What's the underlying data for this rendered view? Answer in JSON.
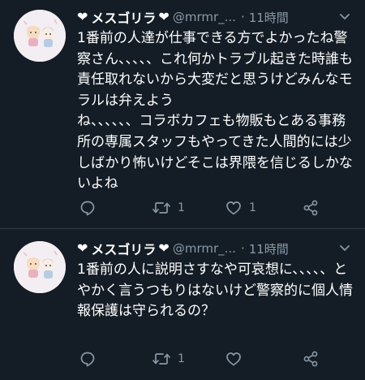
{
  "timeline": {
    "tweets": [
      {
        "heart_left": "❤",
        "display_name": "メスゴリラ",
        "heart_right": "❤",
        "handle": "@mrmr_...",
        "dot": "·",
        "time": "11時間",
        "text": "1番前の人達が仕事できる方でよかったね警察さん、、、、、これ何かトラブル起きた時誰も責任取れないから大変だと思うけどみんなモラルは弁えよう\nね、、、、、、コラボカフェも物販もとある事務所の専属スタッフもやってきた人間的には少しばかり怖いけどそこは界隈を信じるしかないよね",
        "reply_count": "",
        "retweet_count": "1",
        "like_count": "1",
        "icons": {
          "avatar": "avatar-image",
          "menu": "chevron-down-icon",
          "reply": "reply-icon",
          "retweet": "retweet-icon",
          "like": "heart-icon",
          "share": "share-icon"
        }
      },
      {
        "heart_left": "❤",
        "display_name": "メスゴリラ",
        "heart_right": "❤",
        "handle": "@mrmr_...",
        "dot": "·",
        "time": "11時間",
        "text": "1番前の人に説明さすなや可哀想に、、、、、とやかく言うつもりはないけど警察的に個人情報保護は守られるの？",
        "reply_count": "",
        "retweet_count": "1",
        "like_count": "",
        "icons": {
          "avatar": "avatar-image",
          "menu": "chevron-down-icon",
          "reply": "reply-icon",
          "retweet": "retweet-icon",
          "like": "heart-icon",
          "share": "share-icon"
        }
      }
    ]
  },
  "colors": {
    "background": "#141d26",
    "text_primary": "#ffffff",
    "text_secondary": "#8899a6",
    "divider": "#2f3b47"
  }
}
